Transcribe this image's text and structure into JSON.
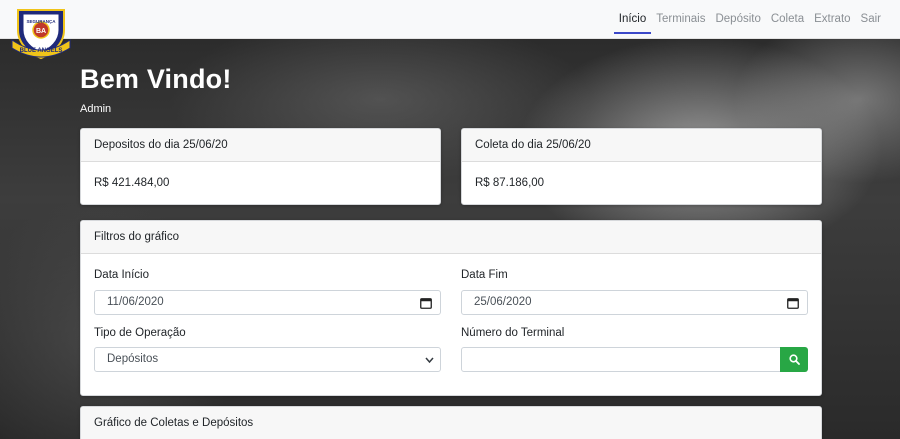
{
  "brand": {
    "logo_text_top": "SEGURANÇA",
    "logo_text_bottom": "BLUE ANGELS"
  },
  "nav": {
    "items": [
      {
        "label": "Início",
        "active": true
      },
      {
        "label": "Terminais",
        "active": false
      },
      {
        "label": "Depósito",
        "active": false
      },
      {
        "label": "Coleta",
        "active": false
      },
      {
        "label": "Extrato",
        "active": false
      },
      {
        "label": "Sair",
        "active": false
      }
    ],
    "active_color": "#3b48c9"
  },
  "header": {
    "title": "Bem Vindo!",
    "user": "Admin"
  },
  "summary": {
    "deposits": {
      "title": "Depositos do dia 25/06/20",
      "value": "R$ 421.484,00"
    },
    "collections": {
      "title": "Coleta do dia 25/06/20",
      "value": "R$ 87.186,00"
    }
  },
  "filters": {
    "title": "Filtros do gráfico",
    "start_date": {
      "label": "Data Início",
      "value": "11/06/2020"
    },
    "end_date": {
      "label": "Data Fim",
      "value": "25/06/2020"
    },
    "operation_type": {
      "label": "Tipo de Operação",
      "selected": "Depósitos"
    },
    "terminal_number": {
      "label": "Número do Terminal",
      "value": "",
      "placeholder": ""
    },
    "search_button_color": "#28a745"
  },
  "chart_card": {
    "title": "Gráfico de Coletas e Depósitos"
  }
}
